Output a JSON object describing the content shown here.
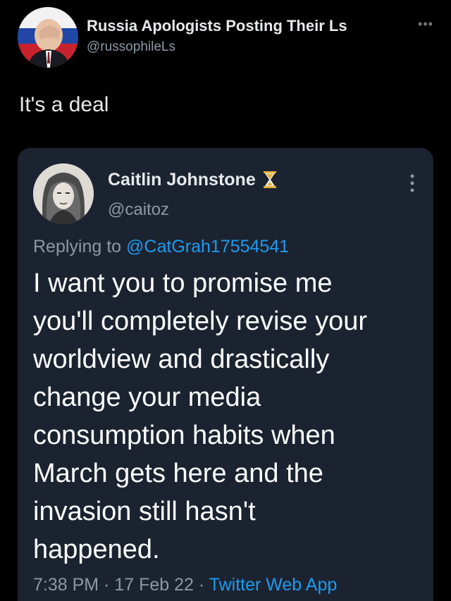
{
  "outer_tweet": {
    "author_name": "Russia Apologists Posting Their Ls",
    "author_handle": "@russophileLs",
    "more_glyph": "•••",
    "text": "It's a deal"
  },
  "quoted_tweet": {
    "author_name": "Caitlin Johnstone",
    "author_handle": "@caitoz",
    "replying_prefix": "Replying to ",
    "replying_mention": "@CatGrah17554541",
    "body_lines": [
      "I want you to promise me",
      "you'll completely revise your",
      "worldview and drastically",
      "change your media",
      "consumption habits when",
      "March gets here and the",
      "invasion still hasn't",
      "happened."
    ],
    "time": "7:38 PM",
    "separator": " · ",
    "date": "17 Feb 22",
    "source_app": "Twitter Web App"
  },
  "colors": {
    "background": "#000000",
    "card": "#1c2330",
    "text_primary": "#e7e9ea",
    "text_secondary": "#8b98a5",
    "accent_link": "#1d9bf0",
    "hourglass": "#e2b13c"
  },
  "icons": {
    "outer_more": "more-horizontal-icon",
    "quote_more": "more-vertical-icon",
    "hourglass": "hourglass-emoji-icon"
  }
}
